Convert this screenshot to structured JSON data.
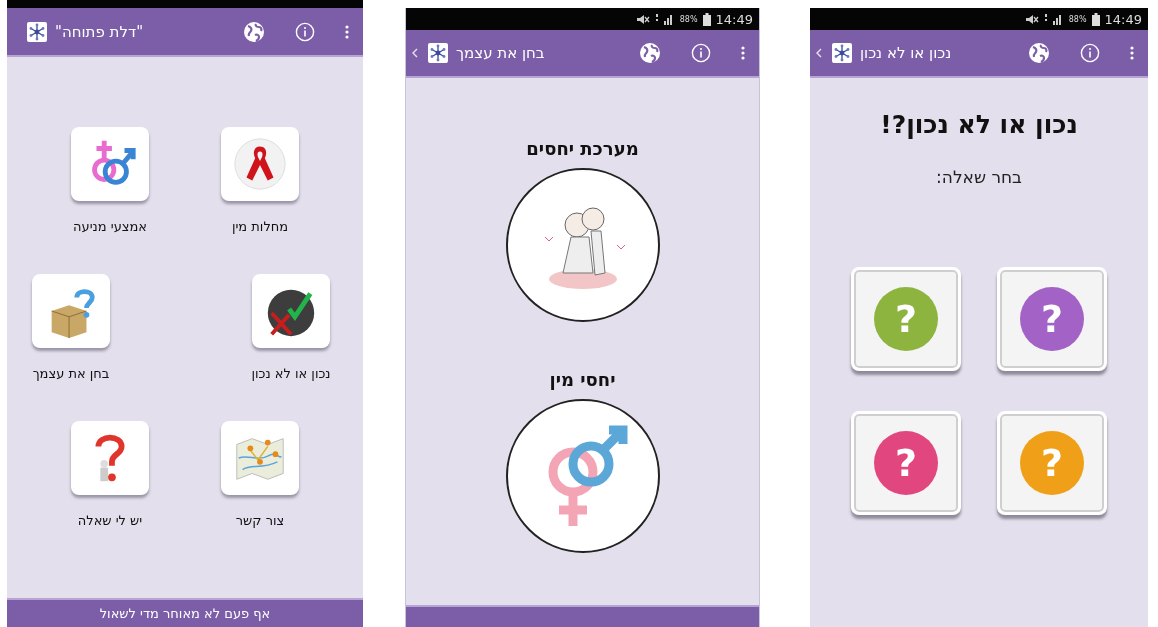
{
  "screens": [
    {
      "kind": "questions",
      "status_bar": {
        "battery": "88%",
        "time": "14:49"
      },
      "app_bar": {
        "title": "נכון או לא נכון",
        "back": true
      },
      "heading": "נכון או לא נכון?!",
      "prompt": "בחר שאלה:",
      "cards": [
        {
          "mark": "?",
          "color": "#a262c6"
        },
        {
          "mark": "?",
          "color": "#8db43f"
        },
        {
          "mark": "?",
          "color": "#f0a018"
        },
        {
          "mark": "?",
          "color": "#e2467e"
        }
      ]
    },
    {
      "kind": "topics",
      "status_bar": {
        "battery": "88%",
        "time": "14:49"
      },
      "app_bar": {
        "title": "בחן את עצמך",
        "back": true
      },
      "sections": [
        {
          "heading": "מערכת יחסים"
        },
        {
          "heading": "יחסי מין"
        }
      ]
    },
    {
      "kind": "home",
      "app_bar": {
        "title": "\"דלת פתוחה\"",
        "back": false
      },
      "tiles": [
        {
          "label": "מחלות מין"
        },
        {
          "label": "אמצעי מניעה"
        },
        {
          "label": "נכון או לא נכון"
        },
        {
          "label": "בחן את עצמך"
        },
        {
          "label": "צור קשר"
        },
        {
          "label": "יש לי שאלה"
        }
      ],
      "footer": "אף פעם לא מאוחר מדי לשאול"
    }
  ]
}
